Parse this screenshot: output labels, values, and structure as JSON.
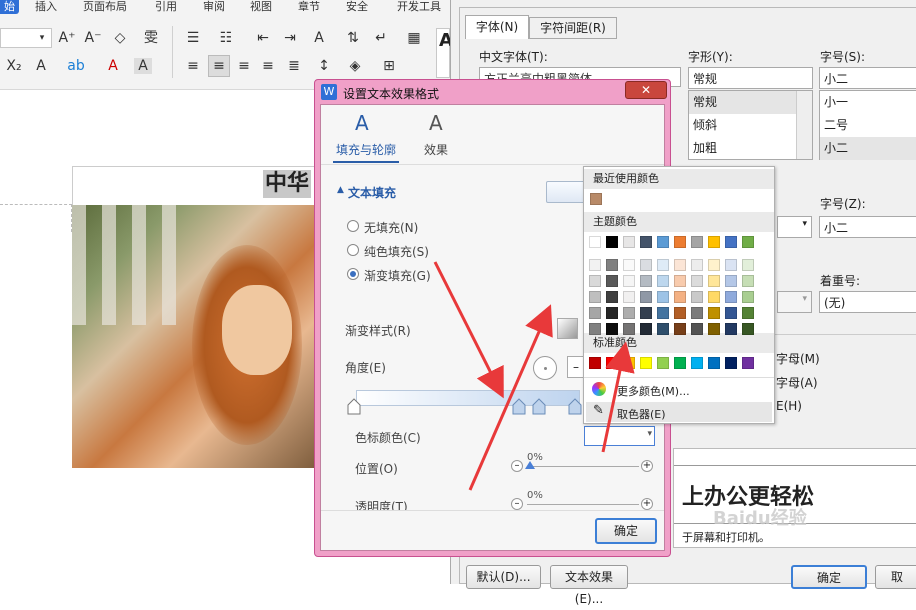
{
  "ribbon": {
    "tabs": [
      "始",
      "插入",
      "页面布局",
      "引用",
      "审阅",
      "视图",
      "章节",
      "安全",
      "开发工具"
    ],
    "active_tab": "始"
  },
  "document": {
    "title_text": "中华",
    "bottom_heading": "上办公更轻松",
    "bottom_text": "于屏幕和打印机。"
  },
  "font_dialog": {
    "tabs": [
      "字体(N)",
      "字符间距(R)"
    ],
    "cn_font_label": "中文字体(T):",
    "cn_font_value": "方正兰亭中粗黑简体",
    "style_label": "字形(Y):",
    "style_value": "常规",
    "style_items": [
      "常规",
      "倾斜",
      "加粗"
    ],
    "size_label": "字号(S):",
    "size_value": "小二",
    "size_items": [
      "小一",
      "二号",
      "小二"
    ],
    "size2_label": "字号(Z):",
    "size2_value": "小二",
    "emphasis_label": "着重号:",
    "emphasis_value": "(无)",
    "check1": "字母(M)",
    "check2": "字母(A)",
    "check3": "E(H)",
    "default_button": "默认(D)...",
    "text_effect_button": "文本效果(E)...",
    "ok_button": "确定",
    "cancel_button": "取"
  },
  "text_effect_dialog": {
    "title": "设置文本效果格式",
    "tab_fill": "填充与轮廓",
    "tab_effect": "效果",
    "section": "文本填充",
    "no_fill": "无填充(N)",
    "solid_fill": "纯色填充(S)",
    "gradient_fill": "渐变填充(G)",
    "gradient_style": "渐变样式(R)",
    "angle": "角度(E)",
    "stop_color": "色标颜色(C)",
    "position": "位置(O)",
    "position_value": "0%",
    "transparency": "透明度(T)",
    "transparency_value": "0%",
    "ok": "确定"
  },
  "color_popup": {
    "recent_label": "最近使用颜色",
    "theme_label": "主题颜色",
    "standard_label": "标准颜色",
    "more_colors": "更多颜色(M)...",
    "eyedropper": "取色器(E)",
    "recent_colors": [
      "#b88a68"
    ],
    "theme_top": [
      "#ffffff",
      "#000000",
      "#e7e6e6",
      "#44546a",
      "#5b9bd5",
      "#ed7d31",
      "#a5a5a5",
      "#ffc000",
      "#4472c4",
      "#70ad47"
    ],
    "standard_colors": [
      "#c00000",
      "#ff0000",
      "#ffc000",
      "#ffff00",
      "#92d050",
      "#00b050",
      "#00b0f0",
      "#0070c0",
      "#002060",
      "#7030a0"
    ]
  },
  "watermark": "Baidu经验"
}
